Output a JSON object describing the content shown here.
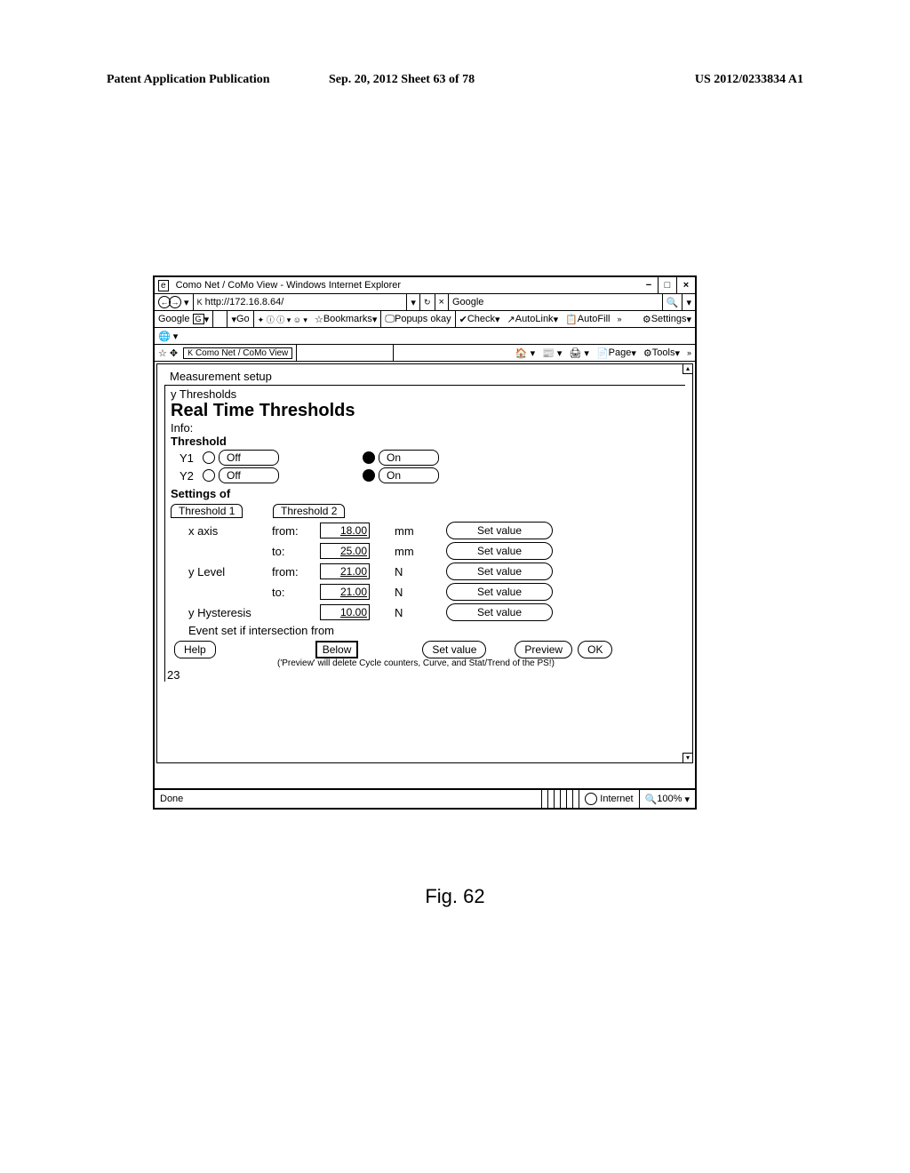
{
  "doc_header": {
    "left": "Patent Application Publication",
    "mid": "Sep. 20, 2012  Sheet 63 of 78",
    "right": "US 2012/0233834 A1"
  },
  "window": {
    "title": "Como Net / CoMo View - Windows Internet Explorer",
    "min": "−",
    "max": "□",
    "close": "×"
  },
  "addrbar": {
    "url": "http://172.16.8.64/",
    "go_label": "Go",
    "search_engine": "Google",
    "search_placeholder": "",
    "search_icon": "🔍"
  },
  "googlebar": {
    "brand": "Google",
    "go": "Go",
    "bookmarks": "Bookmarks",
    "popups": "Popups okay",
    "check": "Check",
    "autolink": "AutoLink",
    "autofill": "AutoFill",
    "settings": "Settings"
  },
  "tabstrip": {
    "tab_title": "Como Net / CoMo View",
    "page": "Page",
    "tools": "Tools"
  },
  "content": {
    "measurement_setup": "Measurement setup",
    "y_thresholds": "y Thresholds",
    "rt_title": "Real Time Thresholds",
    "info": "Info:",
    "threshold": "Threshold",
    "y1": "Y1",
    "y2": "Y2",
    "off": "Off",
    "on": "On",
    "settings_of": "Settings of",
    "tab1": "Threshold 1",
    "tab2": "Threshold 2",
    "xaxis": "x axis",
    "from": "from:",
    "to": "to:",
    "ylevel": "y Level",
    "yhyst": "y Hysteresis",
    "event_set": "Event set if intersection from",
    "below": "Below",
    "set_value": "Set value",
    "help": "Help",
    "preview": "Preview",
    "ok": "OK",
    "preview_note": "('Preview' will delete Cycle counters, Curve, and Stat/Trend of the PS!)",
    "number_23": "23",
    "vals": {
      "xaxis_from": "18.00",
      "xaxis_to": "25.00",
      "ylevel_from": "21.00",
      "ylevel_to": "21.00",
      "yhyst": "10.00"
    },
    "unit_mm": "mm",
    "unit_n": "N"
  },
  "status": {
    "done": "Done",
    "internet": "Internet",
    "zoom": "100%"
  },
  "fig": "Fig. 62"
}
